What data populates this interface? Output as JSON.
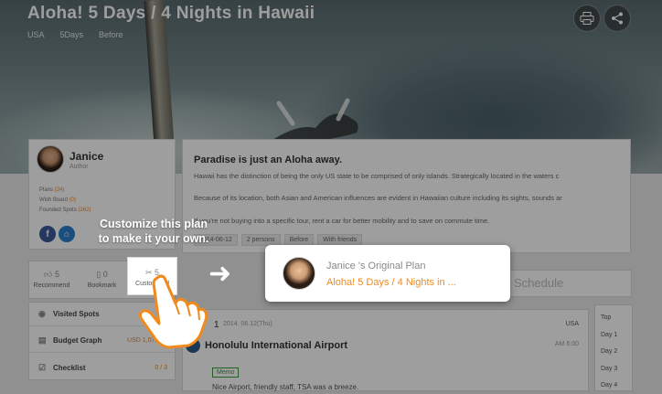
{
  "header": {
    "title": "Aloha! 5 Days / 4 Nights in Hawaii",
    "breadcrumbs": [
      "USA",
      "5Days",
      "Before"
    ]
  },
  "author": {
    "name": "Janice",
    "role": "Author",
    "stats": [
      {
        "label": "Plans",
        "value": "(24)"
      },
      {
        "label": "Wish Board",
        "value": "(0)"
      },
      {
        "label": "Founded Spots",
        "value": "(262)"
      }
    ],
    "social": [
      {
        "icon": "facebook-icon",
        "glyph": "f",
        "color": "#3b5998"
      },
      {
        "icon": "home-icon",
        "glyph": "⌂",
        "color": "#2a7fcb"
      }
    ]
  },
  "plan": {
    "headline": "Paradise is just an Aloha away.",
    "paragraphs": [
      "Hawaii has the distinction of being the only US state to be comprised of only islands. Strategically located in the waters c",
      "Because of its location, both Asian and American influences are evident in Hawaiian culture including its sights, sounds ar",
      "If you're not buying into a specific tour, rent a car for better mobility and to save on commute time."
    ],
    "tags": [
      "2014-06-12",
      "2 persons",
      "Before",
      "With friends"
    ]
  },
  "actions": {
    "recommend": {
      "count": "5",
      "label": "Recommend"
    },
    "bookmark": {
      "count": "0",
      "label": "Bookmark"
    },
    "customized": {
      "count": "5",
      "label": "Customized"
    }
  },
  "menu": {
    "visited_spots": "Visited Spots",
    "budget_graph": "Budget Graph",
    "budget_value": "USD 1,072.00",
    "checklist": "Checklist",
    "checklist_value": "0 / 3"
  },
  "schedule": {
    "label": "Schedule"
  },
  "day": {
    "number": "1",
    "date": "2014. 06.12(Thu)",
    "country": "USA",
    "place": "Honolulu International Airport",
    "time": "AM 6:00",
    "memo_label": "Memo",
    "note": "Nice Airport, friendly staff, TSA was a breeze."
  },
  "day_nav": [
    "Top",
    "Day 1",
    "Day 2",
    "Day 3",
    "Day 4",
    "Day 5"
  ],
  "popup": {
    "owner_line": "Janice 's Original Plan",
    "plan_title": "Aloha! 5 Days / 4 Nights in ..."
  },
  "tip": {
    "line1": "Customize this plan",
    "line2": "to make it your own."
  },
  "colors": {
    "accent": "#f08a1c",
    "stat_value": "#e58a2c",
    "memo": "#3a9a3a"
  }
}
